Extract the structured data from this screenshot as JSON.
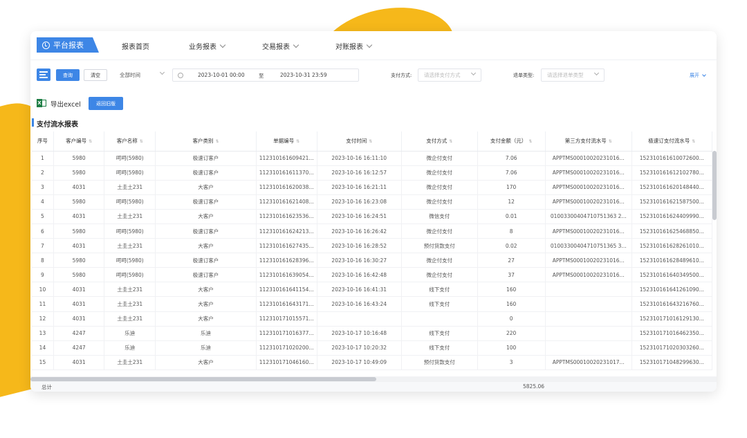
{
  "nav": {
    "brand": "平台报表",
    "items": [
      {
        "label": "报表首页",
        "dropdown": false
      },
      {
        "label": "业务报表",
        "dropdown": true
      },
      {
        "label": "交易报表",
        "dropdown": true
      },
      {
        "label": "对账报表",
        "dropdown": true
      }
    ]
  },
  "filter": {
    "query_label": "查询",
    "clear_label": "清空",
    "time_range": "全部时间",
    "start_date": "2023-10-01 00:00",
    "to_label": "至",
    "end_date": "2023-10-31 23:59",
    "pay_method_label": "支付方式:",
    "pay_method_placeholder": "请选择支付方式",
    "refund_type_label": "退单类型:",
    "refund_type_placeholder": "请选择退单类型",
    "expand_label": "展开"
  },
  "toolbar": {
    "export_label": "导出excel",
    "back_label": "返回旧版"
  },
  "report_title": "支付流水报表",
  "table": {
    "columns": [
      "序号",
      "客户编号",
      "客户名称",
      "客户类别",
      "单据编号",
      "支付时间",
      "支付方式",
      "支付金额（元）",
      "第三方支付流水号",
      "极速订支付流水号"
    ],
    "rows": [
      [
        "1",
        "5980",
        "呵呵(5980)",
        "极速订客户",
        "112310161609421...",
        "2023-10-16 16:11:10",
        "微企付支付",
        "7.06",
        "APPTMS00010020231016...",
        "152310161610072600..."
      ],
      [
        "2",
        "5980",
        "呵呵(5980)",
        "极速订客户",
        "112310161611370...",
        "2023-10-16 16:12:57",
        "微企付支付",
        "7.06",
        "APPTMS00010020231016...",
        "152310161612102780..."
      ],
      [
        "3",
        "4031",
        "土圭土231",
        "大客户",
        "112310161620038...",
        "2023-10-16 16:21:11",
        "微企付支付",
        "170",
        "APPTMS00010020231016...",
        "152310161620148440..."
      ],
      [
        "4",
        "5980",
        "呵呵(5980)",
        "极速订客户",
        "112310161621408...",
        "2023-10-16 16:23:08",
        "微企付支付",
        "12",
        "APPTMS00010020231016...",
        "152310161621587500..."
      ],
      [
        "5",
        "4031",
        "土圭土231",
        "大客户",
        "112310161623536...",
        "2023-10-16 16:24:51",
        "微信支付",
        "0.01",
        "01003300404710751363 2...",
        "152310161624409990..."
      ],
      [
        "6",
        "5980",
        "呵呵(5980)",
        "极速订客户",
        "112310161624213...",
        "2023-10-16 16:26:42",
        "微企付支付",
        "8",
        "APPTMS00010020231016...",
        "152310161625468850..."
      ],
      [
        "7",
        "4031",
        "土圭土231",
        "大客户",
        "112310161627435...",
        "2023-10-16 16:28:52",
        "预付货款支付",
        "0.02",
        "01003300404710751365 3...",
        "152310161628261010..."
      ],
      [
        "8",
        "5980",
        "呵呵(5980)",
        "极速订客户",
        "112310161628396...",
        "2023-10-16 16:30:27",
        "微企付支付",
        "27",
        "APPTMS00010020231016...",
        "152310161628489610..."
      ],
      [
        "9",
        "5980",
        "呵呵(5980)",
        "极速订客户",
        "112310161639054...",
        "2023-10-16 16:42:48",
        "微企付支付",
        "37",
        "APPTMS00010020231016...",
        "152310161640349500..."
      ],
      [
        "10",
        "4031",
        "土圭土231",
        "大客户",
        "112310161641154...",
        "2023-10-16 16:41:31",
        "线下支付",
        "160",
        "",
        "152310161641261090..."
      ],
      [
        "11",
        "4031",
        "土圭土231",
        "大客户",
        "112310161643171...",
        "2023-10-16 16:43:24",
        "线下支付",
        "160",
        "",
        "152310161643216760..."
      ],
      [
        "12",
        "4031",
        "土圭土231",
        "大客户",
        "112310171015571...",
        "",
        "",
        "0",
        "",
        "152310171016129130..."
      ],
      [
        "13",
        "4247",
        "乐迪",
        "乐迪",
        "112310171016377...",
        "2023-10-17 10:16:48",
        "线下支付",
        "220",
        "",
        "152310171016462350..."
      ],
      [
        "14",
        "4247",
        "乐迪",
        "乐迪",
        "112310171020200...",
        "2023-10-17 10:20:32",
        "线下支付",
        "100",
        "",
        "152310171020303260..."
      ],
      [
        "15",
        "4031",
        "土圭土231",
        "大客户",
        "112310171046160...",
        "2023-10-17 10:49:09",
        "预付货款支付",
        "3",
        "APPTMS00010020231017...",
        "152310171048299630..."
      ]
    ]
  },
  "footer": {
    "total_label": "总计",
    "total_amount": "5825.06"
  },
  "colors": {
    "accent": "#3d86e6",
    "blob": "#f6b81a",
    "excel": "#1e7e45"
  }
}
